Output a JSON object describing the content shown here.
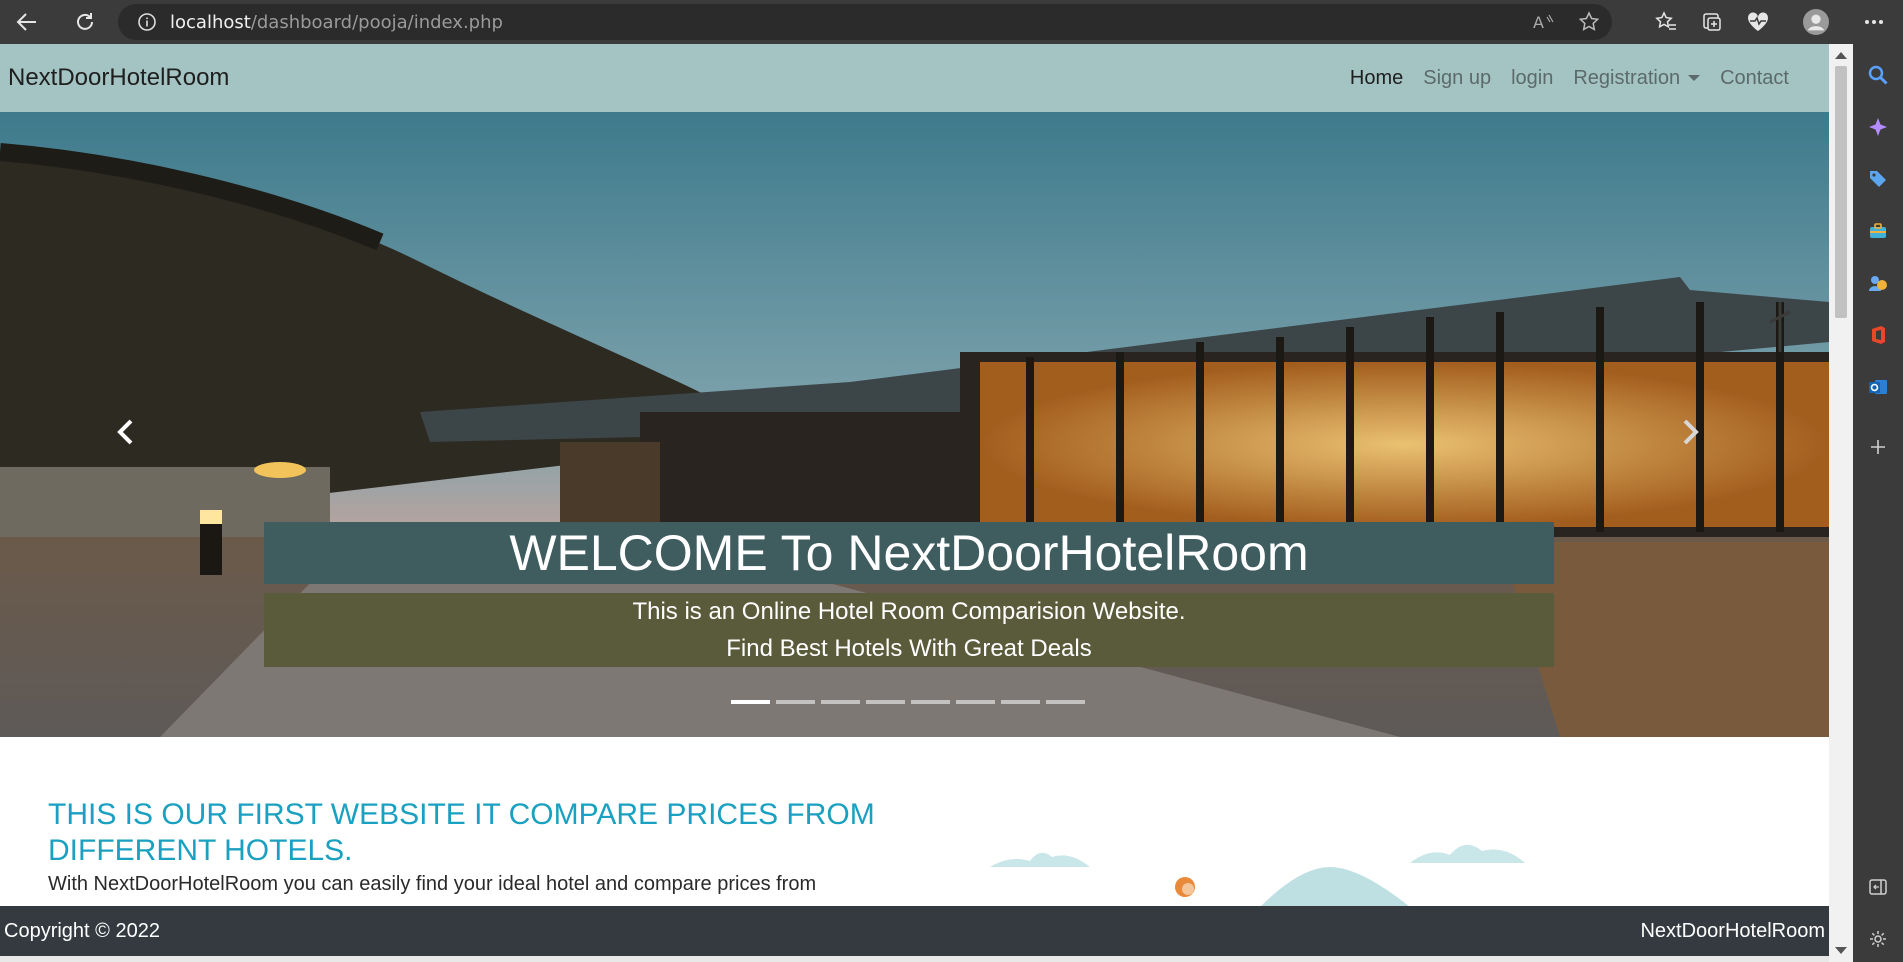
{
  "browser": {
    "url_host": "localhost",
    "url_path": "/dashboard/pooja/index.php",
    "back_icon": "arrow-left-icon",
    "refresh_icon": "refresh-icon"
  },
  "navbar": {
    "brand": "NextDoorHotelRoom",
    "links": [
      {
        "label": "Home",
        "active": true
      },
      {
        "label": "Sign up"
      },
      {
        "label": "login"
      },
      {
        "label": "Registration",
        "dropdown": true
      },
      {
        "label": "Contact"
      }
    ]
  },
  "carousel": {
    "title": "WELCOME To NextDoorHotelRoom",
    "line1": "This is an Online Hotel Room Comparision Website.",
    "line2": "Find Best Hotels With Great Deals",
    "slides": 8,
    "active_slide": 1
  },
  "content": {
    "headline": "THIS IS OUR FIRST WEBSITE IT COMPARE PRICES FROM DIFFERENT HOTELS.",
    "paragraph": "With NextDoorHotelRoom you can easily find your ideal hotel and compare prices from"
  },
  "footer": {
    "copyright": "Copyright © 2022",
    "brand": "NextDoorHotelRoom"
  },
  "colors": {
    "navbar_bg": "#a3c4c2",
    "caption_title_bg": "#3f5c5f",
    "caption_sub_bg": "#5a5b3b",
    "headline": "#1aa0c0",
    "footer_bg": "#343a40"
  }
}
